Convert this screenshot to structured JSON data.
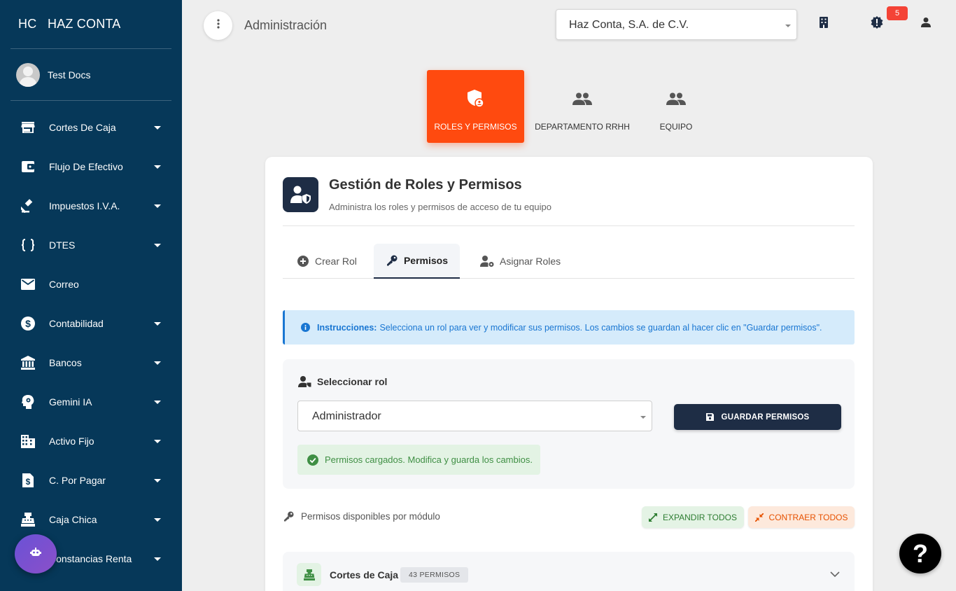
{
  "brand": {
    "mini": "HC",
    "name": "HAZ CONTA"
  },
  "user": {
    "name": "Test Docs"
  },
  "nav": [
    {
      "label": "Cortes De Caja",
      "icon": "store-icon"
    },
    {
      "label": "Flujo De Efectivo",
      "icon": "wallet-icon"
    },
    {
      "label": "Impuestos I.V.A.",
      "icon": "gavel-icon"
    },
    {
      "label": "DTES",
      "icon": "braces-icon"
    },
    {
      "label": "Correo",
      "icon": "mail-icon"
    },
    {
      "label": "Contabilidad",
      "icon": "dollar-circle-icon"
    },
    {
      "label": "Bancos",
      "icon": "bank-icon"
    },
    {
      "label": "Gemini IA",
      "icon": "brain-head-icon"
    },
    {
      "label": "Activo Fijo",
      "icon": "building-icon"
    },
    {
      "label": "C. Por Pagar",
      "icon": "invoice-icon"
    },
    {
      "label": "Caja Chica",
      "icon": "cash-register-icon"
    },
    {
      "label": "Constancias Renta",
      "icon": "document-icon"
    }
  ],
  "header": {
    "title": "Administración",
    "company": "Haz Conta, S.A. de C.V.",
    "notifications_count": "5"
  },
  "module_tabs": [
    {
      "label": "ROLES Y PERMISOS",
      "icon": "shield-user-icon"
    },
    {
      "label": "DEPARTAMENTO RRHH",
      "icon": "group-icon"
    },
    {
      "label": "EQUIPO",
      "icon": "group-icon"
    }
  ],
  "card": {
    "title": "Gestión de Roles y Permisos",
    "subtitle": "Administra los roles y permisos de acceso de tu equipo",
    "tabs": [
      {
        "label": "Crear Rol"
      },
      {
        "label": "Permisos"
      },
      {
        "label": "Asignar Roles"
      }
    ],
    "info_label": "Instrucciones:",
    "info_text": "Selecciona un rol para ver y modificar sus permisos. Los cambios se guardan al hacer clic en \"Guardar permisos\".",
    "select_heading": "Seleccionar rol",
    "selected_role": "Administrador",
    "save_label": "GUARDAR PERMISOS",
    "success_text": "Permisos cargados. Modifica y guarda los cambios.",
    "perm_label": "Permisos disponibles por módulo",
    "expand_label": "EXPANDIR TODOS",
    "contract_label": "CONTRAER TODOS",
    "module": {
      "name": "Cortes de Caja",
      "count": "43 PERMISOS"
    }
  },
  "help_label": "?",
  "colors": {
    "sidebar": "#063859",
    "accent": "#ff4a0f",
    "dark": "#1e2d45",
    "info": "#1976d2",
    "success": "#3f8f44"
  }
}
